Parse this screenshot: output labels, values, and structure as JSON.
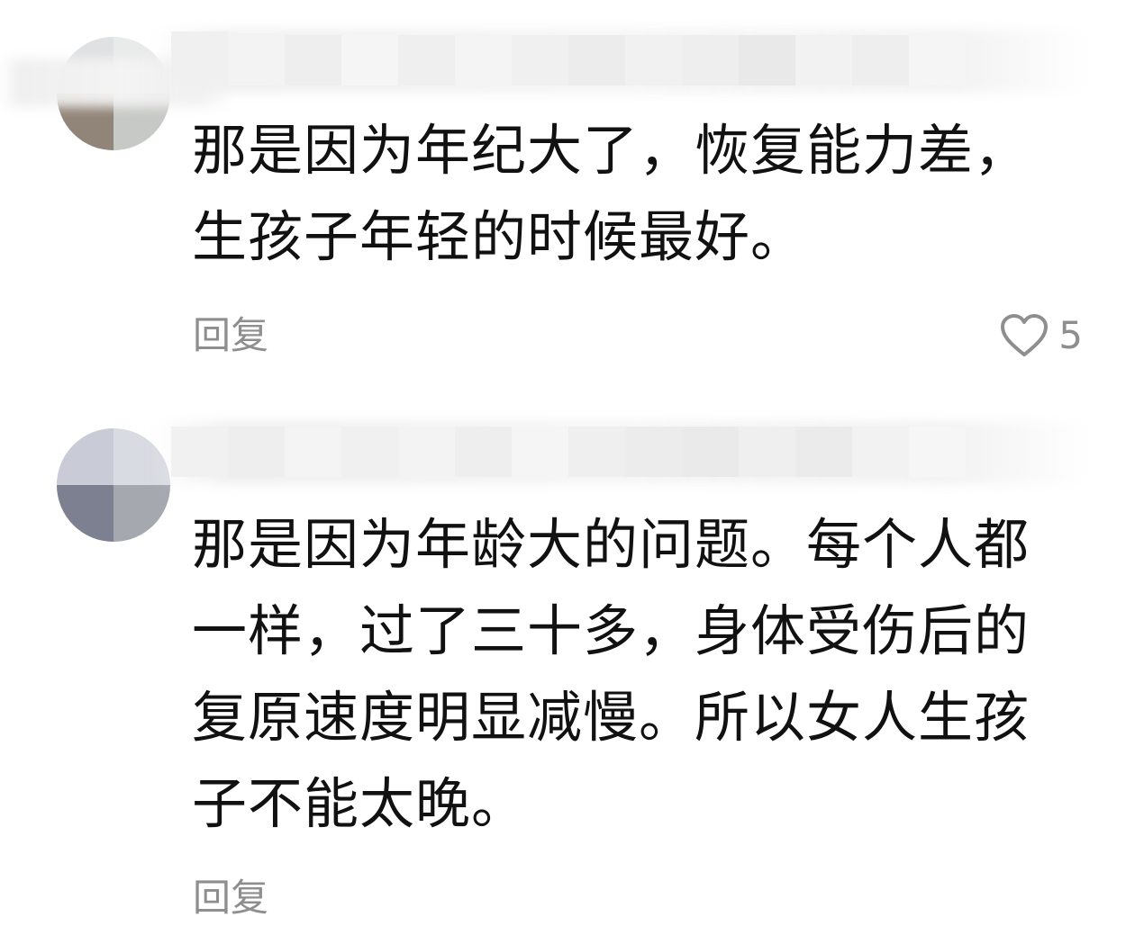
{
  "comments": [
    {
      "text": "那是因为年纪大了，恢复能力差，\n生孩子年轻的时候最好。",
      "reply_label": "回复",
      "like_count": "5",
      "like_icon": "heart-outline-icon"
    },
    {
      "text": "那是因为年龄大的问题。每个人都\n一样，过了三十多，身体受伤后的\n复原速度明显减慢。所以女人生孩\n子不能太晚。",
      "reply_label": "回复"
    }
  ],
  "colors": {
    "text": "#111111",
    "secondary": "#8e8e8e",
    "background": "#ffffff"
  }
}
